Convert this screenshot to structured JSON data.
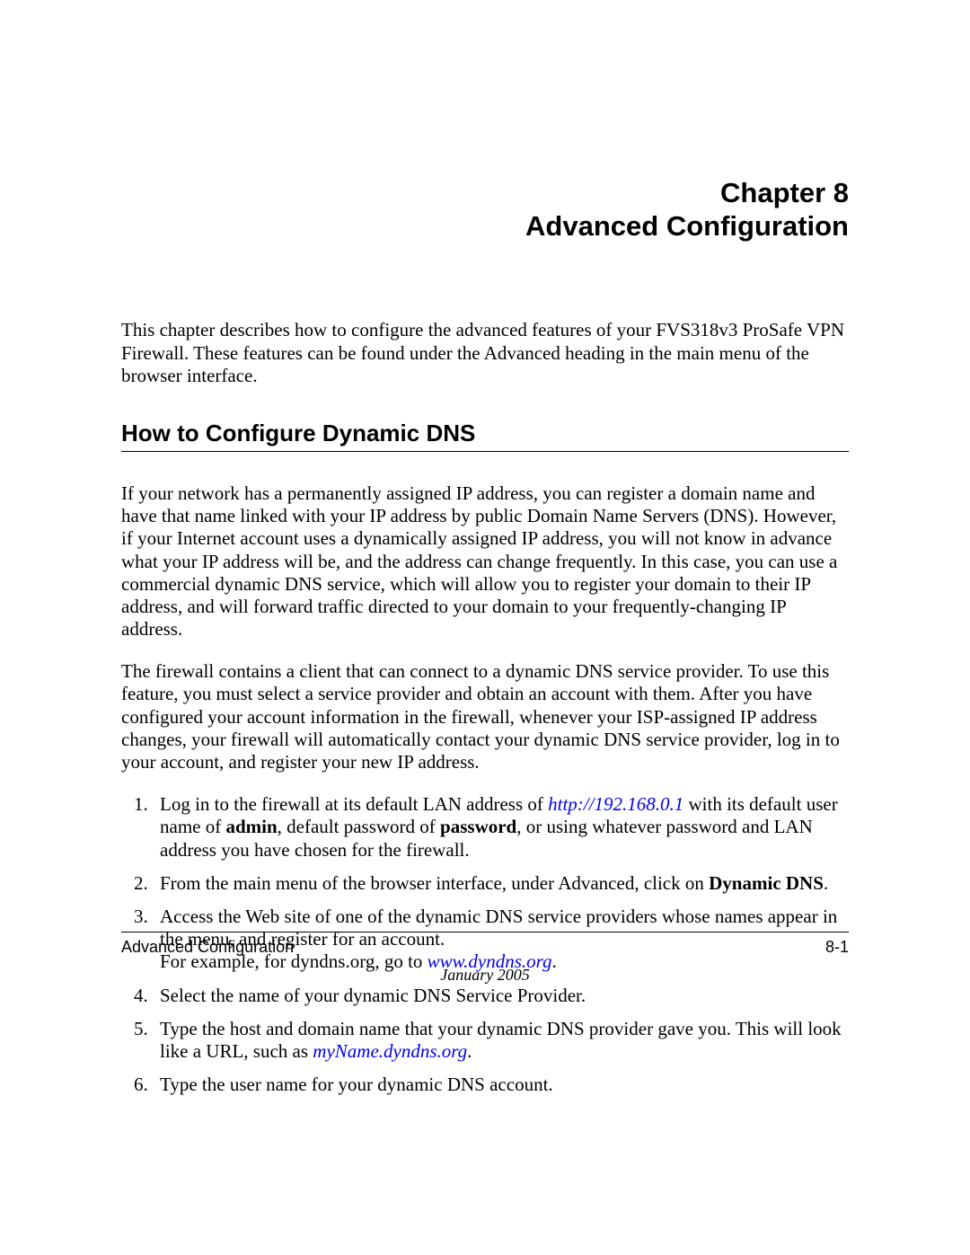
{
  "chapter": {
    "line1": "Chapter 8",
    "line2": "Advanced Configuration"
  },
  "intro": "This chapter describes how to configure the advanced features of your FVS318v3 ProSafe VPN Firewall. These features can be found under the Advanced heading in the main menu of the browser interface.",
  "section": {
    "heading": "How to Configure Dynamic DNS",
    "p1": "If your network has a permanently assigned IP address, you can register a domain name and have that name linked with your IP address by public Domain Name Servers (DNS). However, if your Internet account uses a dynamically assigned IP address, you will not know in advance what your IP address will be, and the address can change frequently. In this case, you can use a commercial dynamic DNS service, which will allow you to register your domain to their IP address, and will forward traffic directed to your domain to your frequently-changing IP address.",
    "p2": "The firewall contains a client that can connect to a dynamic DNS service provider. To use this feature, you must select a service provider and obtain an account with them. After you have configured your account information in the firewall, whenever your ISP-assigned IP address changes, your firewall will automatically contact your dynamic DNS service provider, log in to your account, and register your new IP address."
  },
  "steps": {
    "s1_pre": "Log in to the firewall at its default LAN address of ",
    "s1_link": "http://192.168.0.1",
    "s1_mid1": " with its default user name of ",
    "s1_b1": "admin",
    "s1_mid2": ", default password of ",
    "s1_b2": "password",
    "s1_post": ", or using whatever password and LAN address you have chosen for the firewall.",
    "s2_pre": "From the main menu of the browser interface, under Advanced, click on ",
    "s2_b": "Dynamic DNS",
    "s2_post": ".",
    "s3_pre": "Access the Web site of one of the dynamic DNS service providers whose names appear in the menu, and register for an account.",
    "s3_line2_pre": "For example, for dyndns.org, go to ",
    "s3_link": "www.dyndns.org",
    "s3_post": ".",
    "s4": "Select the name of your dynamic DNS Service Provider.",
    "s5_pre": "Type the host and domain name that your dynamic DNS provider gave you. This will look like a URL, such as ",
    "s5_link": "myName.dyndns.org",
    "s5_post": ".",
    "s6": "Type the user name for your dynamic DNS account."
  },
  "footer": {
    "left": "Advanced Configuration",
    "right": "8-1",
    "date": "January 2005"
  }
}
